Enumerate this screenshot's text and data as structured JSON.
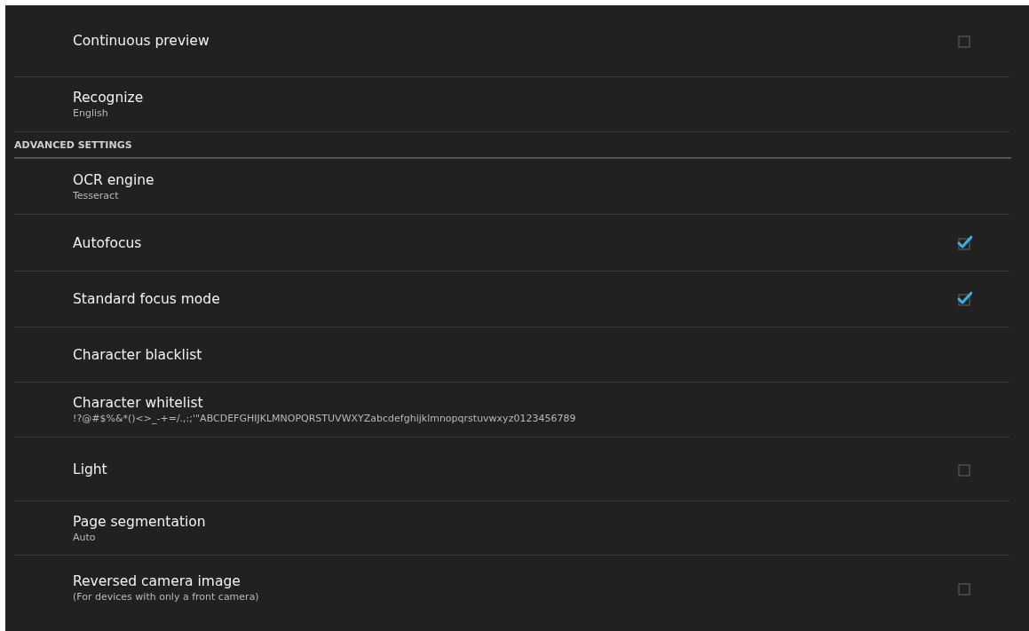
{
  "items": [
    {
      "kind": "checkbox",
      "title": "Continuous preview",
      "checked": false
    },
    {
      "kind": "text",
      "title": "Recognize",
      "summary": "English"
    },
    {
      "kind": "category",
      "title": "ADVANCED SETTINGS"
    },
    {
      "kind": "text",
      "title": "OCR engine",
      "summary": "Tesseract"
    },
    {
      "kind": "checkbox",
      "title": "Autofocus",
      "checked": true
    },
    {
      "kind": "checkbox",
      "title": "Standard focus mode",
      "checked": true
    },
    {
      "kind": "text",
      "title": "Character blacklist"
    },
    {
      "kind": "text",
      "title": "Character whitelist",
      "summary": "!?@#$%&*()<>_-+=/.,:;'\"ABCDEFGHIJKLMNOPQRSTUVWXYZabcdefghijklmnopqrstuvwxyz0123456789"
    },
    {
      "kind": "checkbox",
      "title": "Light",
      "checked": false
    },
    {
      "kind": "text",
      "title": "Page segmentation",
      "summary": "Auto"
    },
    {
      "kind": "checkbox",
      "title": "Reversed camera image",
      "summary": "(For devices with only a front camera)",
      "checked": false
    }
  ]
}
